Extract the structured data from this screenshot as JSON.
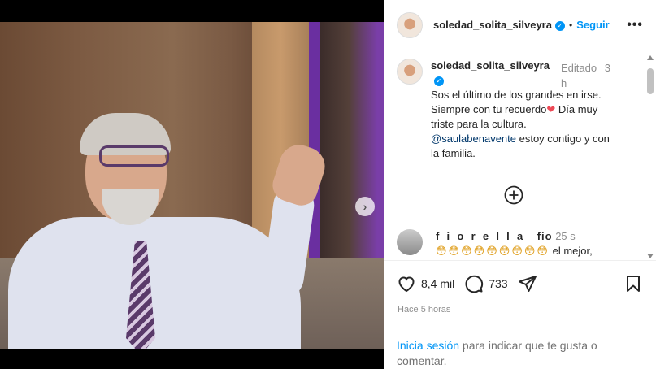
{
  "header": {
    "username": "soledad_solita_silveyra",
    "separator": "•",
    "follow_label": "Seguir",
    "more_icon": "more-horizontal-icon"
  },
  "caption": {
    "username": "soledad_solita_silveyra",
    "edited": "Editado",
    "time": "3 h",
    "text_1": "Sos el último de los grandes en irse. Siempre con tu recuerdo",
    "heart": "❤",
    "text_2": " Día muy triste para la cultura.",
    "mention": "@saulabenavente",
    "text_3": " estoy contigo y con la familia."
  },
  "comment": {
    "username": "f_i_o_r_e_l_l_a__fio",
    "time": "25 s",
    "emojis": "😳😳😳😳😳😳😳😳😳",
    "text": "el mejor,"
  },
  "actions": {
    "likes": "8,4 mil",
    "comments": "733",
    "posted": "Hace 5 horas"
  },
  "login": {
    "link": "Inicia sesión",
    "text": " para indicar que te gusta o comentar."
  },
  "colors": {
    "accent": "#0095f6",
    "heart": "#ed4956"
  }
}
